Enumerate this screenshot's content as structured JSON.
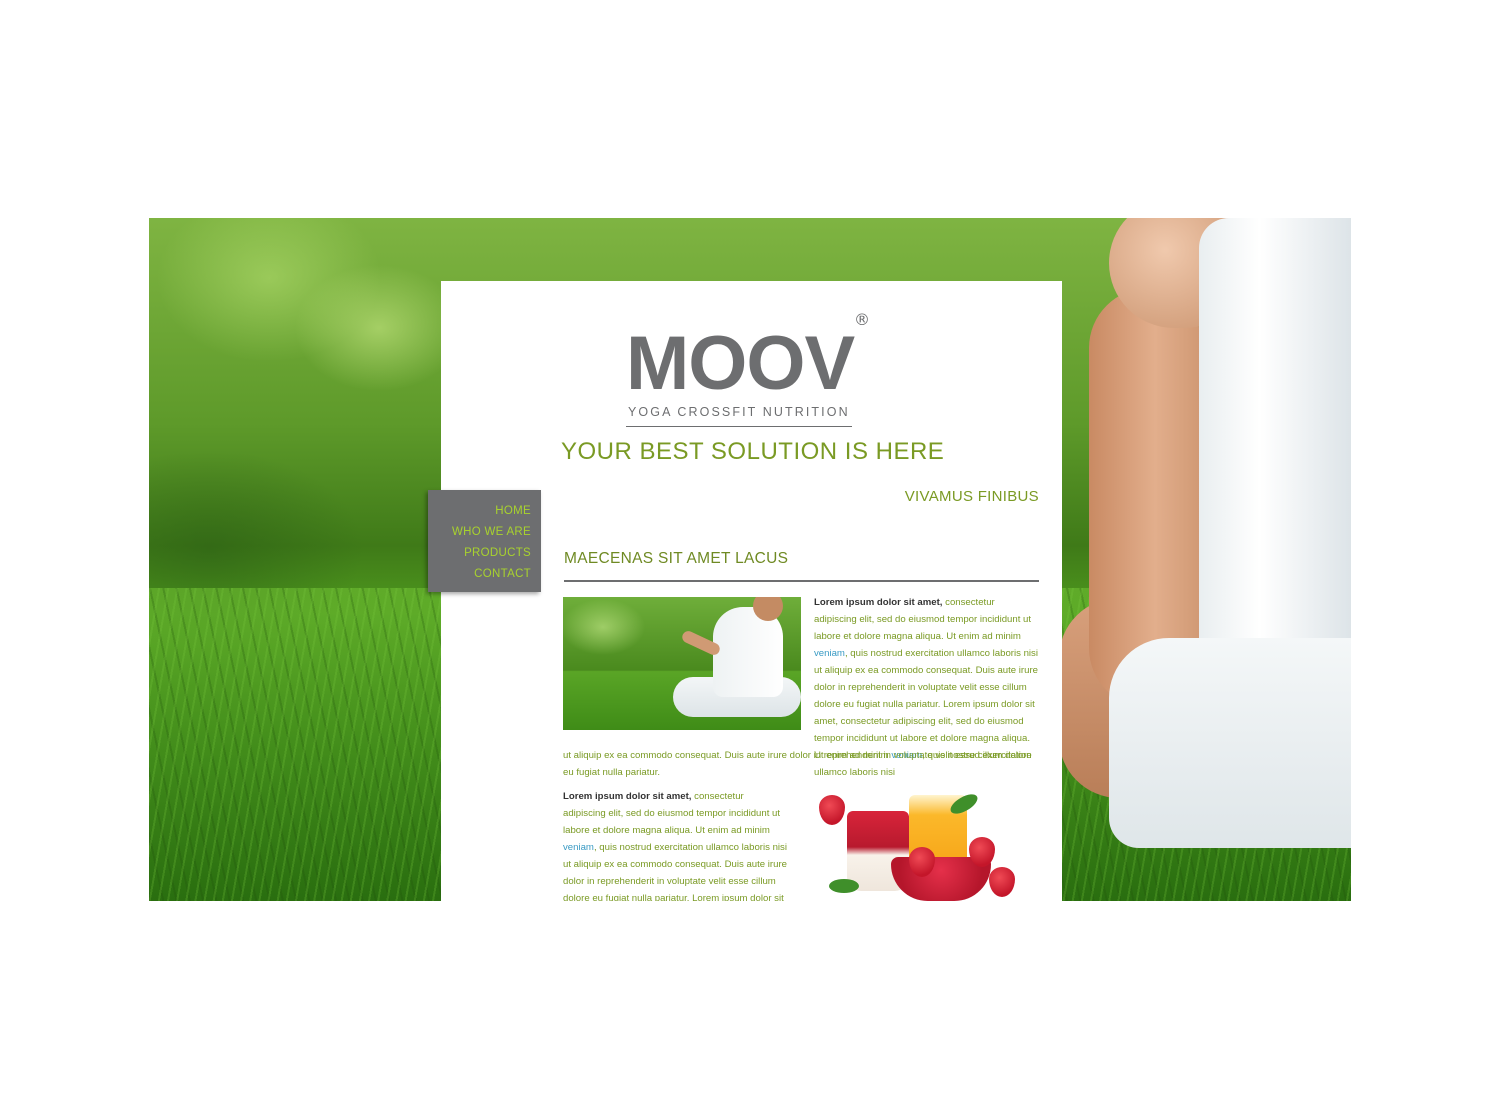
{
  "brand": {
    "name": "MOOV",
    "registered": "®",
    "tagline": "YOGA CROSSFIT NUTRITION"
  },
  "hero": {
    "headline": "YOUR BEST SOLUTION IS HERE",
    "subheading": "VIVAMUS FINIBUS"
  },
  "nav": {
    "items": [
      {
        "label": "HOME"
      },
      {
        "label": "WHO WE ARE"
      },
      {
        "label": "PRODUCTS"
      },
      {
        "label": "CONTACT"
      }
    ]
  },
  "section": {
    "title": "MAECENAS SIT AMET LACUS",
    "para1": {
      "lead": "Lorem ipsum dolor sit amet,",
      "text_a": " consectetur adipiscing elit, sed do eiusmod tempor incididunt ut labore et dolore magna aliqua. Ut enim ad minim ",
      "link_a": "veniam",
      "text_b": ", quis nostrud exercitation ullamco laboris nisi ut aliquip ex ea commodo consequat. Duis aute irure dolor in reprehenderit in voluptate velit esse cillum dolore eu fugiat nulla pariatur. Lorem ipsum dolor sit amet, consectetur adipiscing elit, sed do eiusmod tempor incididunt ut labore et dolore magna aliqua. Ut enim ad minim ",
      "link_b": "veniam",
      "text_c": ", quis nostrud exercitation ullamco laboris nisi",
      "continuation": "ut aliquip ex ea commodo consequat. Duis aute irure dolor in reprehenderit in voluptate velit esse cillum dolore eu fugiat nulla pariatur."
    },
    "para2": {
      "lead": "Lorem ipsum dolor sit amet,",
      "text_a": " consectetur adipiscing elit, sed do eiusmod tempor incididunt ut labore et dolore magna aliqua. Ut enim ad minim ",
      "link_a": "veniam",
      "text_b": ", quis nostrud exercitation ullamco laboris nisi ut aliquip ex ea commodo consequat. Duis aute irure dolor in reprehenderit in voluptate velit esse cillum dolore eu fugiat nulla pariatur. Lorem ipsum dolor sit amet, consectetur adipiscing elit, sed do eiusmod tempor"
    }
  },
  "colors": {
    "accent_green": "#7a9a24",
    "nav_green": "#a8d22e",
    "logo_gray": "#6d6e70",
    "link_blue": "#3a9bc4"
  }
}
